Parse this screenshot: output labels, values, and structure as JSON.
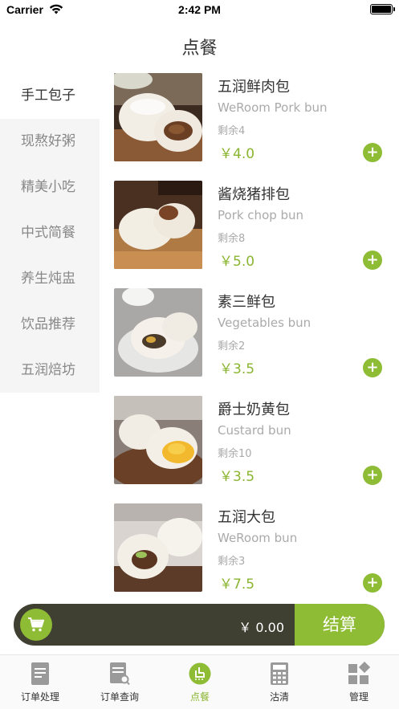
{
  "status_bar": {
    "carrier": "Carrier",
    "time": "2:42 PM"
  },
  "nav": {
    "title": "点餐"
  },
  "sidebar": {
    "items": [
      {
        "label": "手工包子",
        "active": true
      },
      {
        "label": "现熬好粥",
        "active": false
      },
      {
        "label": "精美小吃",
        "active": false
      },
      {
        "label": "中式简餐",
        "active": false
      },
      {
        "label": "养生炖盅",
        "active": false
      },
      {
        "label": "饮品推荐",
        "active": false
      },
      {
        "label": "五润焙坊",
        "active": false
      }
    ]
  },
  "products": [
    {
      "name": "五润鲜肉包",
      "english": "WeRoom Pork bun",
      "stock": "剩余4",
      "price": "￥4.0",
      "add": "+"
    },
    {
      "name": "酱烧猪排包",
      "english": "Pork chop bun",
      "stock": "剩余8",
      "price": "￥5.0",
      "add": "+"
    },
    {
      "name": "素三鲜包",
      "english": "Vegetables bun",
      "stock": "剩余2",
      "price": "￥3.5",
      "add": "+"
    },
    {
      "name": "爵士奶黄包",
      "english": "Custard bun",
      "stock": "剩余10",
      "price": "￥3.5",
      "add": "+"
    },
    {
      "name": "五润大包",
      "english": "WeRoom  bun",
      "stock": "剩余3",
      "price": "￥7.5",
      "add": "+"
    }
  ],
  "cart": {
    "total": "￥ 0.00",
    "checkout_label": "结算"
  },
  "tabs": [
    {
      "label": "订单处理",
      "icon": "order-process-icon",
      "active": false
    },
    {
      "label": "订单查询",
      "icon": "order-search-icon",
      "active": false
    },
    {
      "label": "点餐",
      "icon": "order-food-icon",
      "active": true
    },
    {
      "label": "沽清",
      "icon": "calculator-icon",
      "active": false
    },
    {
      "label": "管理",
      "icon": "manage-icon",
      "active": false
    }
  ],
  "colors": {
    "accent": "#8fbc35",
    "cart_bar": "#3f3f32",
    "sidebar_bg": "#f5f5f5"
  }
}
